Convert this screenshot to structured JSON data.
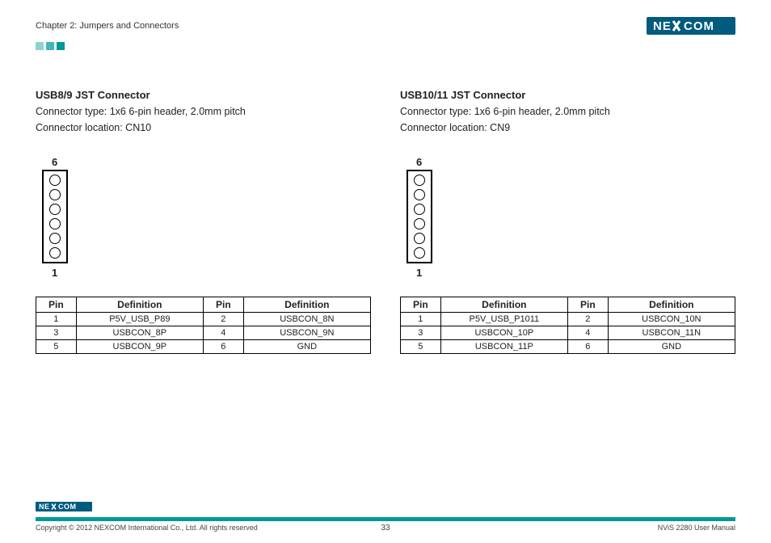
{
  "header": {
    "chapter": "Chapter 2: Jumpers and Connectors",
    "brand": "NE COM"
  },
  "sections": [
    {
      "title": "USB8/9 JST Connector",
      "type_line": "Connector type: 1x6 6-pin header, 2.0mm pitch",
      "location_line": "Connector location: CN10",
      "top_pin_label": "6",
      "bottom_pin_label": "1",
      "table_headers": [
        "Pin",
        "Definition",
        "Pin",
        "Definition"
      ],
      "rows": [
        [
          "1",
          "P5V_USB_P89",
          "2",
          "USBCON_8N"
        ],
        [
          "3",
          "USBCON_8P",
          "4",
          "USBCON_9N"
        ],
        [
          "5",
          "USBCON_9P",
          "6",
          "GND"
        ]
      ]
    },
    {
      "title": "USB10/11 JST Connector",
      "type_line": "Connector type: 1x6 6-pin header, 2.0mm pitch",
      "location_line": "Connector location: CN9",
      "top_pin_label": "6",
      "bottom_pin_label": "1",
      "table_headers": [
        "Pin",
        "Definition",
        "Pin",
        "Definition"
      ],
      "rows": [
        [
          "1",
          "P5V_USB_P1011",
          "2",
          "USBCON_10N"
        ],
        [
          "3",
          "USBCON_10P",
          "4",
          "USBCON_11N"
        ],
        [
          "5",
          "USBCON_11P",
          "6",
          "GND"
        ]
      ]
    }
  ],
  "footer": {
    "brand": "NE COM",
    "copyright": "Copyright © 2012 NEXCOM International Co., Ltd. All rights reserved",
    "page_number": "33",
    "doc_title": "NViS 2280 User Manual"
  }
}
